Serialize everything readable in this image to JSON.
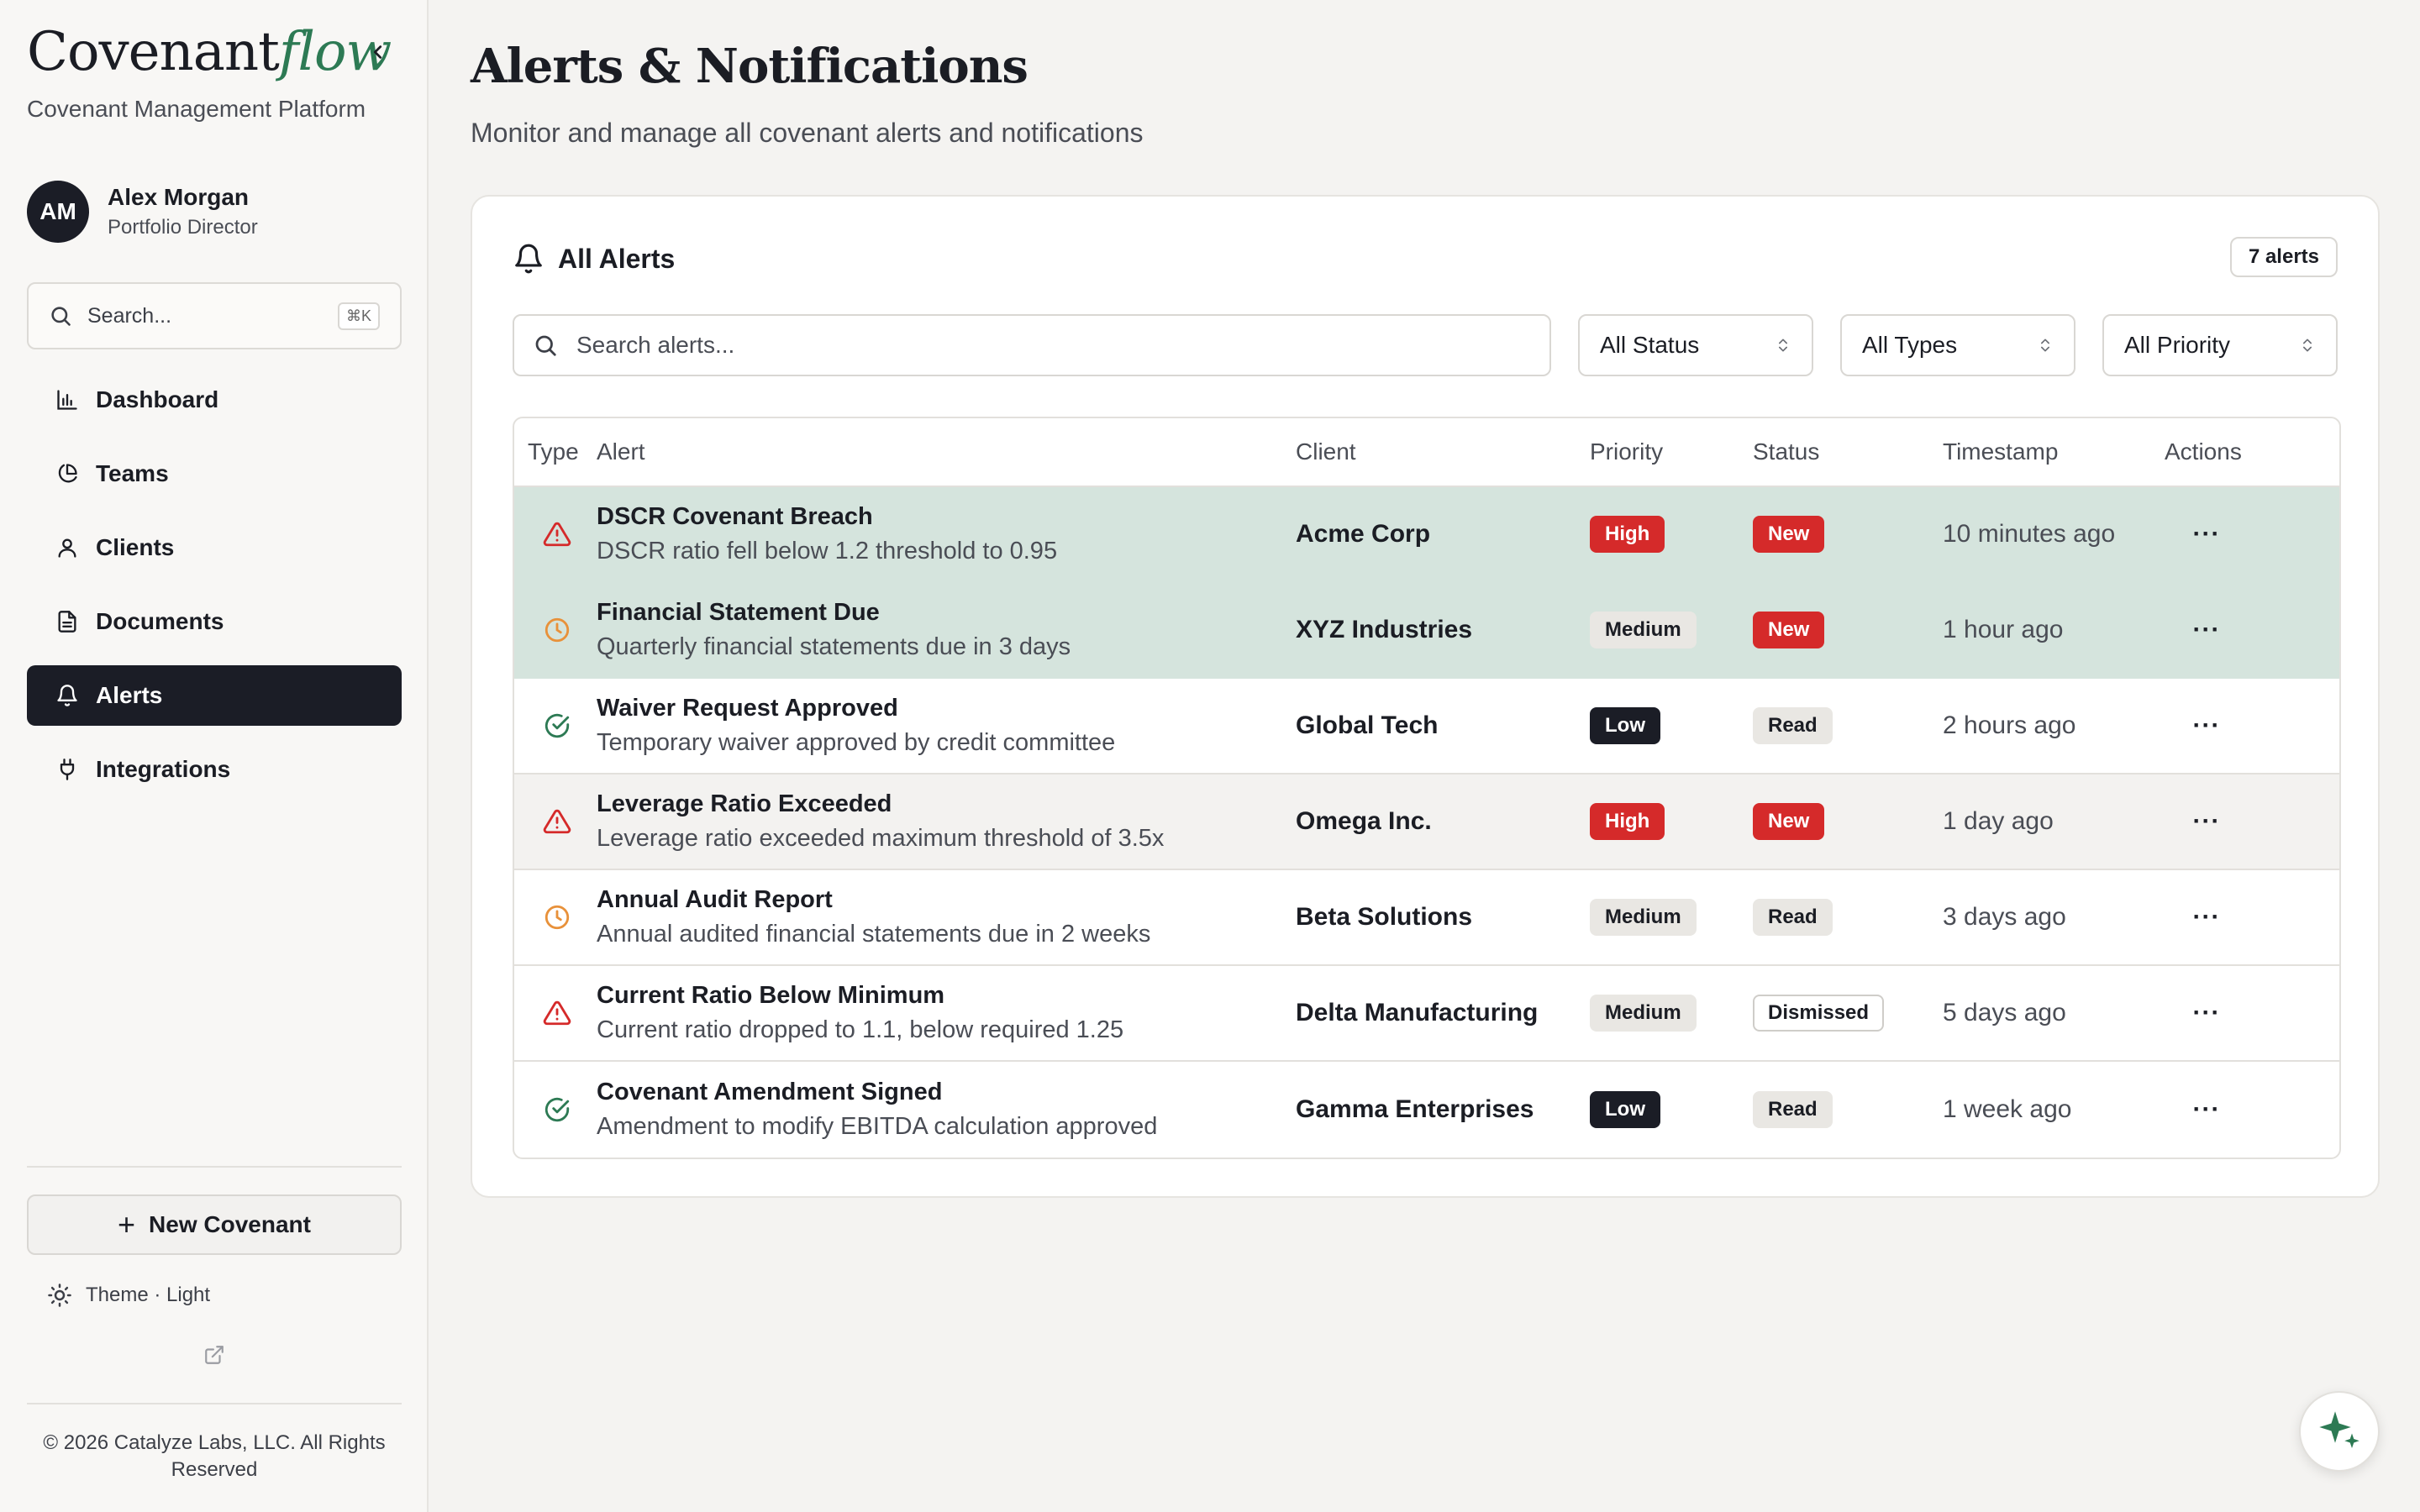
{
  "brand": {
    "word": "Covenant",
    "flow": "flow",
    "subtitle": "Covenant Management Platform"
  },
  "user": {
    "initials": "AM",
    "name": "Alex Morgan",
    "role": "Portfolio Director"
  },
  "sidebar_search": {
    "placeholder": "Search...",
    "shortcut": "⌘K"
  },
  "nav": {
    "items": [
      {
        "label": "Dashboard",
        "icon": "bar-chart-icon"
      },
      {
        "label": "Teams",
        "icon": "pie-chart-icon"
      },
      {
        "label": "Clients",
        "icon": "user-icon"
      },
      {
        "label": "Documents",
        "icon": "document-icon"
      },
      {
        "label": "Alerts",
        "icon": "bell-icon",
        "active": true
      },
      {
        "label": "Integrations",
        "icon": "plug-icon"
      }
    ]
  },
  "sidebar_footer": {
    "new_covenant": "New Covenant",
    "theme": "Theme · Light",
    "copyright": "© 2026 Catalyze Labs, LLC. All Rights Reserved"
  },
  "page": {
    "title": "Alerts & Notifications",
    "subtitle": "Monitor and manage all covenant alerts and notifications"
  },
  "card": {
    "title": "All Alerts",
    "count": "7 alerts",
    "search_placeholder": "Search alerts...",
    "filters": {
      "status": "All Status",
      "types": "All Types",
      "priority": "All Priority"
    }
  },
  "table": {
    "headers": {
      "type": "Type",
      "alert": "Alert",
      "client": "Client",
      "priority": "Priority",
      "status": "Status",
      "timestamp": "Timestamp",
      "actions": "Actions"
    },
    "rows": [
      {
        "type": "warning",
        "title": "DSCR Covenant Breach",
        "description": "DSCR ratio fell below 1.2 threshold to 0.95",
        "client": "Acme Corp",
        "priority": "High",
        "status": "New",
        "timestamp": "10 minutes ago"
      },
      {
        "type": "deadline",
        "title": "Financial Statement Due",
        "description": "Quarterly financial statements due in 3 days",
        "client": "XYZ Industries",
        "priority": "Medium",
        "status": "New",
        "timestamp": "1 hour ago"
      },
      {
        "type": "success",
        "title": "Waiver Request Approved",
        "description": "Temporary waiver approved by credit committee",
        "client": "Global Tech",
        "priority": "Low",
        "status": "Read",
        "timestamp": "2 hours ago"
      },
      {
        "type": "warning",
        "title": "Leverage Ratio Exceeded",
        "description": "Leverage ratio exceeded maximum threshold of 3.5x",
        "client": "Omega Inc.",
        "priority": "High",
        "status": "New",
        "timestamp": "1 day ago"
      },
      {
        "type": "deadline",
        "title": "Annual Audit Report",
        "description": "Annual audited financial statements due in 2 weeks",
        "client": "Beta Solutions",
        "priority": "Medium",
        "status": "Read",
        "timestamp": "3 days ago"
      },
      {
        "type": "warning",
        "title": "Current Ratio Below Minimum",
        "description": "Current ratio dropped to 1.1, below required 1.25",
        "client": "Delta Manufacturing",
        "priority": "Medium",
        "status": "Dismissed",
        "timestamp": "5 days ago"
      },
      {
        "type": "success",
        "title": "Covenant Amendment Signed",
        "description": "Amendment to modify EBITDA calculation approved",
        "client": "Gamma Enterprises",
        "priority": "Low",
        "status": "Read",
        "timestamp": "1 week ago"
      }
    ]
  },
  "colors": {
    "accent_green": "#2d7a54",
    "dark": "#1b1d26",
    "danger": "#d52a2a",
    "warning_orange": "#e8913a",
    "highlight_row": "#d5e4dd"
  }
}
